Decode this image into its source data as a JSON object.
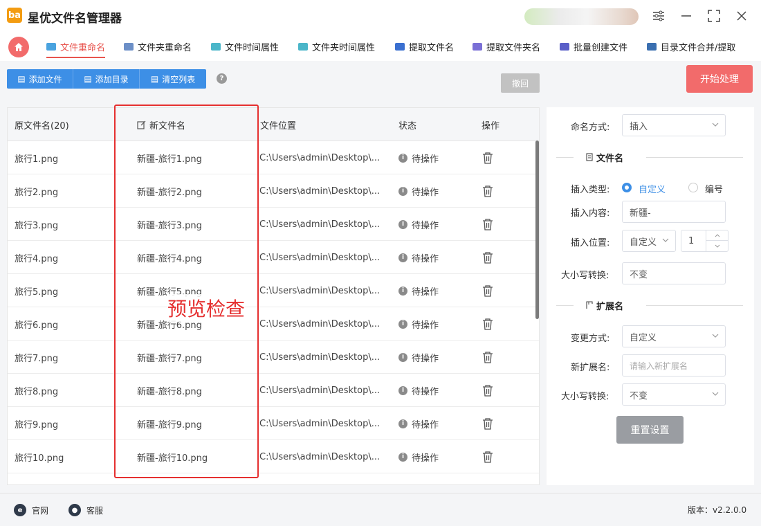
{
  "app": {
    "title": "星优文件名管理器",
    "logo_text": "ba"
  },
  "nav": {
    "tabs": [
      {
        "label": "文件重命名",
        "color": "#4aa3df"
      },
      {
        "label": "文件夹重命名",
        "color": "#6c8fc7"
      },
      {
        "label": "文件时间属性",
        "color": "#4bb6c9"
      },
      {
        "label": "文件夹时间属性",
        "color": "#4bb6c9"
      },
      {
        "label": "提取文件名",
        "color": "#3a6fd0"
      },
      {
        "label": "提取文件夹名",
        "color": "#7a6fd6"
      },
      {
        "label": "批量创建文件",
        "color": "#5a5fc8"
      },
      {
        "label": "目录文件合并/提取",
        "color": "#3a6fb0"
      }
    ]
  },
  "toolbar": {
    "add_file": "添加文件",
    "add_dir": "添加目录",
    "clear_list": "清空列表",
    "help": "?",
    "undo": "撤回",
    "start": "开始处理"
  },
  "table": {
    "headers": [
      "原文件名(20)",
      "新文件名",
      "文件位置",
      "状态",
      "操作"
    ],
    "rows": [
      {
        "orig": "旅行1.png",
        "new": "新疆-旅行1.png",
        "path": "C:\\Users\\admin\\Desktop\\...",
        "status": "待操作"
      },
      {
        "orig": "旅行2.png",
        "new": "新疆-旅行2.png",
        "path": "C:\\Users\\admin\\Desktop\\...",
        "status": "待操作"
      },
      {
        "orig": "旅行3.png",
        "new": "新疆-旅行3.png",
        "path": "C:\\Users\\admin\\Desktop\\...",
        "status": "待操作"
      },
      {
        "orig": "旅行4.png",
        "new": "新疆-旅行4.png",
        "path": "C:\\Users\\admin\\Desktop\\...",
        "status": "待操作"
      },
      {
        "orig": "旅行5.png",
        "new": "新疆-旅行5.png",
        "path": "C:\\Users\\admin\\Desktop\\...",
        "status": "待操作"
      },
      {
        "orig": "旅行6.png",
        "new": "新疆-旅行6.png",
        "path": "C:\\Users\\admin\\Desktop\\...",
        "status": "待操作"
      },
      {
        "orig": "旅行7.png",
        "new": "新疆-旅行7.png",
        "path": "C:\\Users\\admin\\Desktop\\...",
        "status": "待操作"
      },
      {
        "orig": "旅行8.png",
        "new": "新疆-旅行8.png",
        "path": "C:\\Users\\admin\\Desktop\\...",
        "status": "待操作"
      },
      {
        "orig": "旅行9.png",
        "new": "新疆-旅行9.png",
        "path": "C:\\Users\\admin\\Desktop\\...",
        "status": "待操作"
      },
      {
        "orig": "旅行10.png",
        "new": "新疆-旅行10.png",
        "path": "C:\\Users\\admin\\Desktop\\...",
        "status": "待操作"
      }
    ]
  },
  "annotation": {
    "text": "预览检查",
    "color": "#e52f2f"
  },
  "panel": {
    "naming_mode_label": "命名方式:",
    "naming_mode_value": "插入",
    "filename_section": "文件名",
    "insert_type_label": "插入类型:",
    "insert_type_custom": "自定义",
    "insert_type_number": "编号",
    "insert_content_label": "插入内容:",
    "insert_content_value": "新疆-",
    "insert_pos_label": "插入位置:",
    "insert_pos_value": "自定义",
    "insert_pos_num": "1",
    "case_label": "大小写转换:",
    "case_value": "不变",
    "ext_section": "扩展名",
    "change_mode_label": "变更方式:",
    "change_mode_value": "自定义",
    "new_ext_label": "新扩展名:",
    "new_ext_placeholder": "请输入新扩展名",
    "ext_case_label": "大小写转换:",
    "ext_case_value": "不变",
    "reset": "重置设置"
  },
  "footer": {
    "website": "官网",
    "support": "客服",
    "version": "版本：v2.2.0.0"
  },
  "colors": {
    "accent": "#3d8fe6",
    "primary_red": "#f26b6b",
    "active_tab": "#e8544e"
  }
}
